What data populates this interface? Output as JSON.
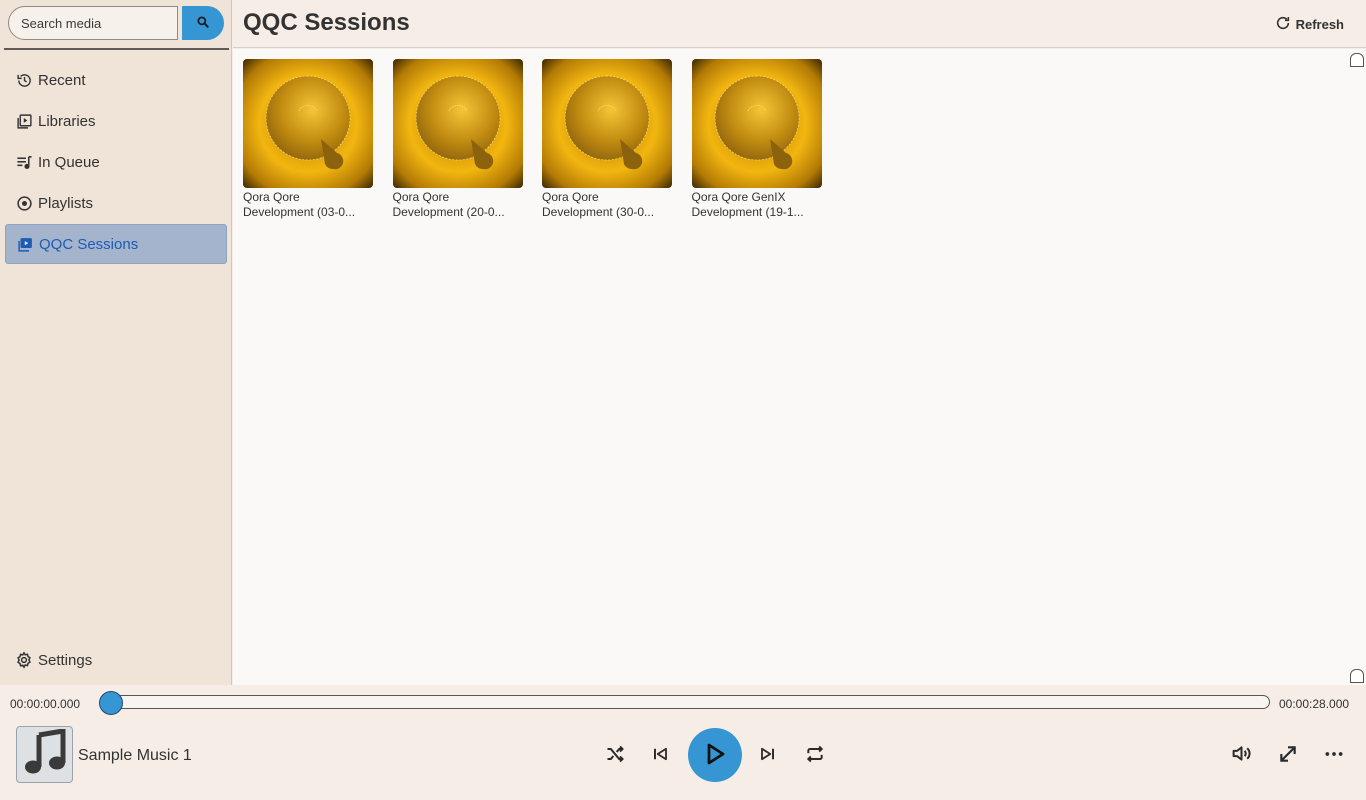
{
  "search": {
    "placeholder": "Search media",
    "value": ""
  },
  "sidebar": {
    "items": [
      {
        "label": "Recent",
        "icon": "history-icon",
        "active": false
      },
      {
        "label": "Libraries",
        "icon": "library-icon",
        "active": false
      },
      {
        "label": "In Queue",
        "icon": "queue-icon",
        "active": false
      },
      {
        "label": "Playlists",
        "icon": "playlist-icon",
        "active": false
      },
      {
        "label": "QQC Sessions",
        "icon": "sessions-icon",
        "active": true
      }
    ],
    "settings_label": "Settings"
  },
  "header": {
    "title": "QQC Sessions",
    "refresh_label": "Refresh"
  },
  "sessions": [
    {
      "line1": "Qora Qore",
      "line2": "Development (03-0..."
    },
    {
      "line1": "Qora Qore",
      "line2": "Development (20-0..."
    },
    {
      "line1": "Qora Qore",
      "line2": "Development (30-0..."
    },
    {
      "line1": "Qora Qore GenIX",
      "line2": "Development (19-1..."
    }
  ],
  "player": {
    "current_time": "00:00:00.000",
    "total_time": "00:00:28.000",
    "progress": 0,
    "track_name": "Sample Music 1",
    "album_art_icon": "music-note-icon"
  },
  "colors": {
    "accent": "#3596d3",
    "active_nav_bg": "#a3b4cc",
    "active_nav_text": "#1e5bb4",
    "sidebar_bg": "#f0e4d8",
    "thumb_gold": "#f0b415"
  }
}
